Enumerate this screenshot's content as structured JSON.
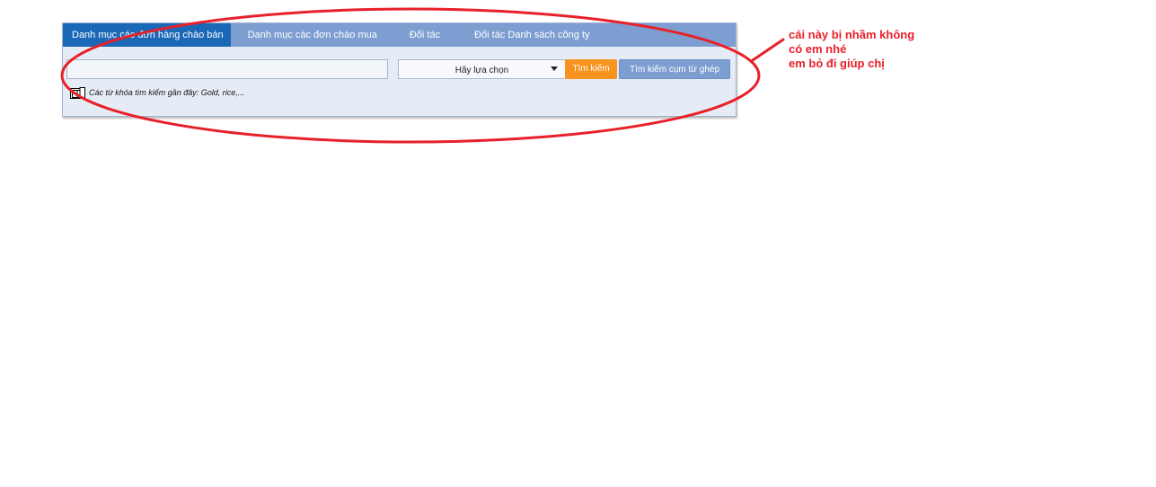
{
  "tabs": [
    {
      "label": "Danh mục các đơn hàng chào bán",
      "active": true
    },
    {
      "label": "Danh mục các đơn chào mua",
      "active": false
    },
    {
      "label": "Đối tác",
      "active": false
    },
    {
      "label": "Đối tác Danh sách công ty",
      "active": false
    }
  ],
  "search": {
    "value": "",
    "placeholder": "",
    "select_value": "Hãy lựa chọn",
    "search_button": "Tìm kiếm",
    "phrase_button": "Tìm kiếm cụm từ ghép"
  },
  "recent_keywords": "Các từ khóa tìm kiếm gần đây: Gold, rice,...",
  "annotation": {
    "line1": "cái này bị nhầm không",
    "line2": "có em nhé",
    "line3": "em bỏ đi giúp chị",
    "color": "#e8202a"
  },
  "colors": {
    "tab_bar": "#7d9ed0",
    "tab_active": "#1b68b7",
    "search_button": "#f7931e",
    "panel_background": "#e6ecf5"
  },
  "icons": {
    "recent": "book-icon",
    "select": "chevron-down-icon"
  }
}
